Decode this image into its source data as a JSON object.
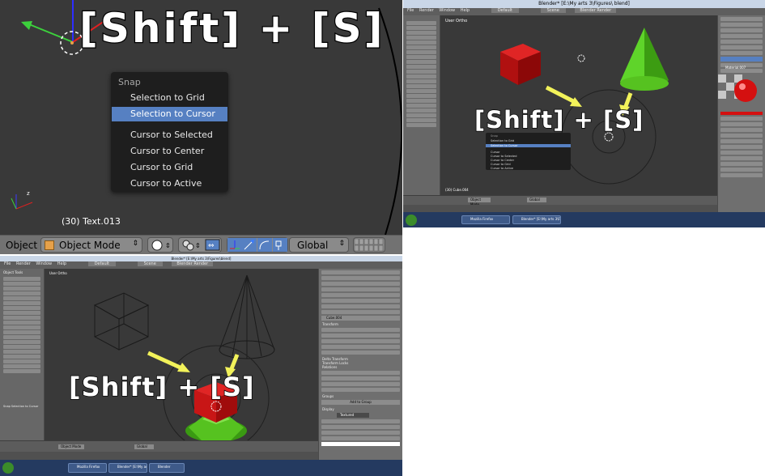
{
  "panel_a": {
    "overlay_text": "[Shift] + [S]",
    "snap_menu": {
      "title": "Snap",
      "items": [
        "Selection to Grid",
        "Selection to Cursor",
        "Cursor to Selected",
        "Cursor to Center",
        "Cursor to Grid",
        "Cursor to Active"
      ],
      "active_index": 1
    },
    "status_text": "(30) Text.013",
    "header": {
      "object_label": "Object",
      "mode": "Object Mode",
      "orientation": "Global"
    }
  },
  "panel_b": {
    "title": "Blender* [E:\\My arts 3\\Figures\\ blend]",
    "menus": [
      "File",
      "Render",
      "Window",
      "Help"
    ],
    "layout": "Default",
    "scene": "Scene",
    "engine": "Blender Render",
    "view_label": "User Ortho",
    "overlay_text": "[Shift] + [S]",
    "snap_menu": {
      "title": "Snap",
      "items": [
        "Selection to Grid",
        "Selection to Cursor",
        "Cursor",
        "Cursor to Selected",
        "Cursor to Center",
        "Cursor to Grid",
        "Cursor to Active"
      ]
    },
    "status_text": "(30) Cube.004",
    "mode": "Object Mode",
    "orientation": "Global",
    "material": "Material.007",
    "taskbar_items": [
      "Mozilla Firefox",
      "Blender* [E:\\My arts 3\\F...",
      "Blender"
    ],
    "accent_colors": {
      "cube": "#c01414",
      "cone": "#4fc41c",
      "arrow": "#f2f25a",
      "highlight": "#5680c2"
    }
  },
  "panel_c": {
    "title": "Blender* [E:\\My arts 3\\Figures\\blend]",
    "menus": [
      "File",
      "Render",
      "Window",
      "Help"
    ],
    "layout": "Default",
    "scene": "Scene",
    "engine": "Blender Render",
    "view_label": "User Ortho",
    "overlay_text": "[Shift] + [S]",
    "tool_panel_title": "Object Tools",
    "bottom_panel": "Snap Selection to Cursor",
    "status_text": "(30) Cube.004",
    "mode": "Object Mode",
    "orientation": "Global",
    "object_name": "Cube.004",
    "sections": [
      "Transform",
      "Delta Transform",
      "Transform Locks",
      "Relations",
      "Groups",
      "Display"
    ],
    "add_to_group": "Add to Group",
    "display_type": "Textured",
    "taskbar_items": [
      "Blender* [E:\\My arts 3\\F...",
      "Blender",
      "Mozilla Firefox"
    ]
  }
}
